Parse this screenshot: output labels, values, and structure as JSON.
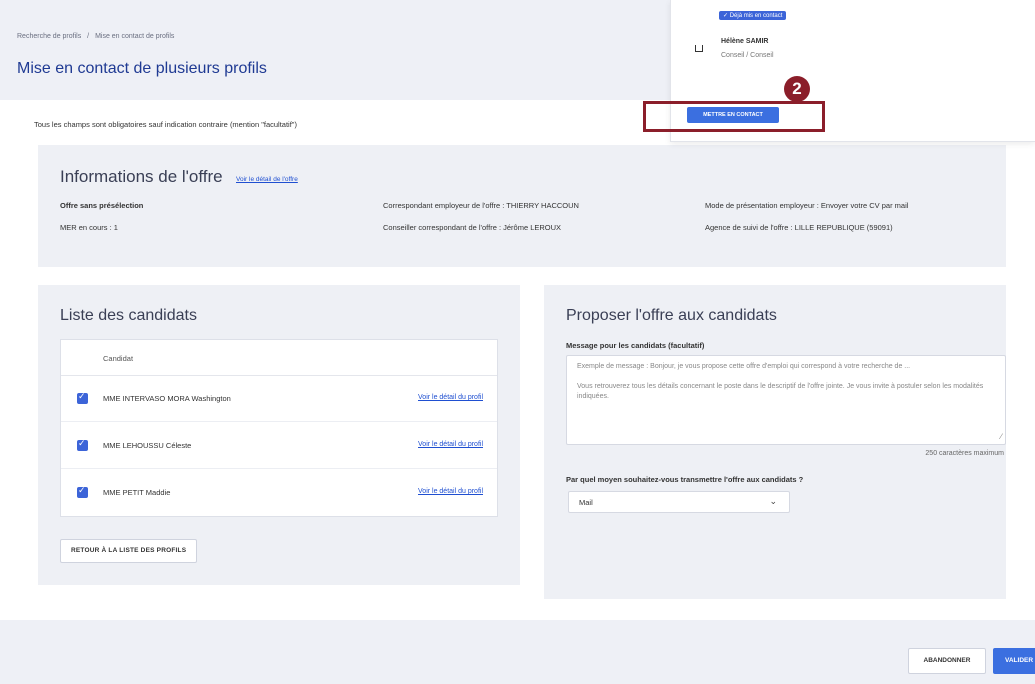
{
  "breadcrumb": [
    "Recherche de profils",
    "/",
    "Mise en contact de profils"
  ],
  "page_title": "Mise en contact de plusieurs profils",
  "mandatory_note": "Tous les champs sont obligatoires sauf indication contraire (mention \"facultatif\")",
  "offer": {
    "title": "Informations de l'offre",
    "detail_link": "Voir le détail de l'offre",
    "fields": [
      "Offre sans présélection",
      "MER en cours : 1",
      "Correspondant employeur de l'offre : THIERRY HACCOUN",
      "Conseiller correspondant de l'offre : Jérôme LEROUX",
      "Mode de présentation employeur : Envoyer votre CV par mail",
      "Agence de suivi de l'offre : LILLE REPUBLIQUE (59091)"
    ]
  },
  "candidates": {
    "title": "Liste des candidats",
    "column_header": "Candidat",
    "rows": [
      {
        "name": "MME INTERVASO MORA Washington",
        "link": "Voir le détail du profil"
      },
      {
        "name": "MME LEHOUSSU Céleste",
        "link": "Voir le détail du profil"
      },
      {
        "name": "MME PETIT Maddie",
        "link": "Voir le détail du profil"
      }
    ],
    "back_button": "RETOUR À LA LISTE DES PROFILS"
  },
  "propose": {
    "title": "Proposer l'offre aux candidats",
    "message_label": "Message pour les candidats (facultatif)",
    "message_placeholder_1": "Exemple de message : Bonjour, je vous propose cette offre d'emploi qui correspond à votre recherche de ...",
    "message_placeholder_2": "Vous retrouverez tous les détails concernant le poste dans le descriptif de l'offre jointe. Je vous invite à postuler selon les modalités indiquées.",
    "char_count": "250 caractères maximum",
    "channel_label": "Par quel moyen souhaitez-vous transmettre l'offre aux candidats ?",
    "channel_value": "Mail"
  },
  "footer": {
    "cancel": "ABANDONNER",
    "validate": "VALIDER"
  },
  "popup": {
    "badge": "✓ Déjà mis en contact",
    "name": "Hélène SAMIR",
    "sub": "Conseil / Conseil",
    "button": "METTRE EN CONTACT"
  },
  "step_number": "2",
  "colors": {
    "accent": "#3b6fe0",
    "title_blue": "#1f3a93",
    "highlight": "#8b1e2a",
    "panel_bg": "#eef0f5"
  }
}
